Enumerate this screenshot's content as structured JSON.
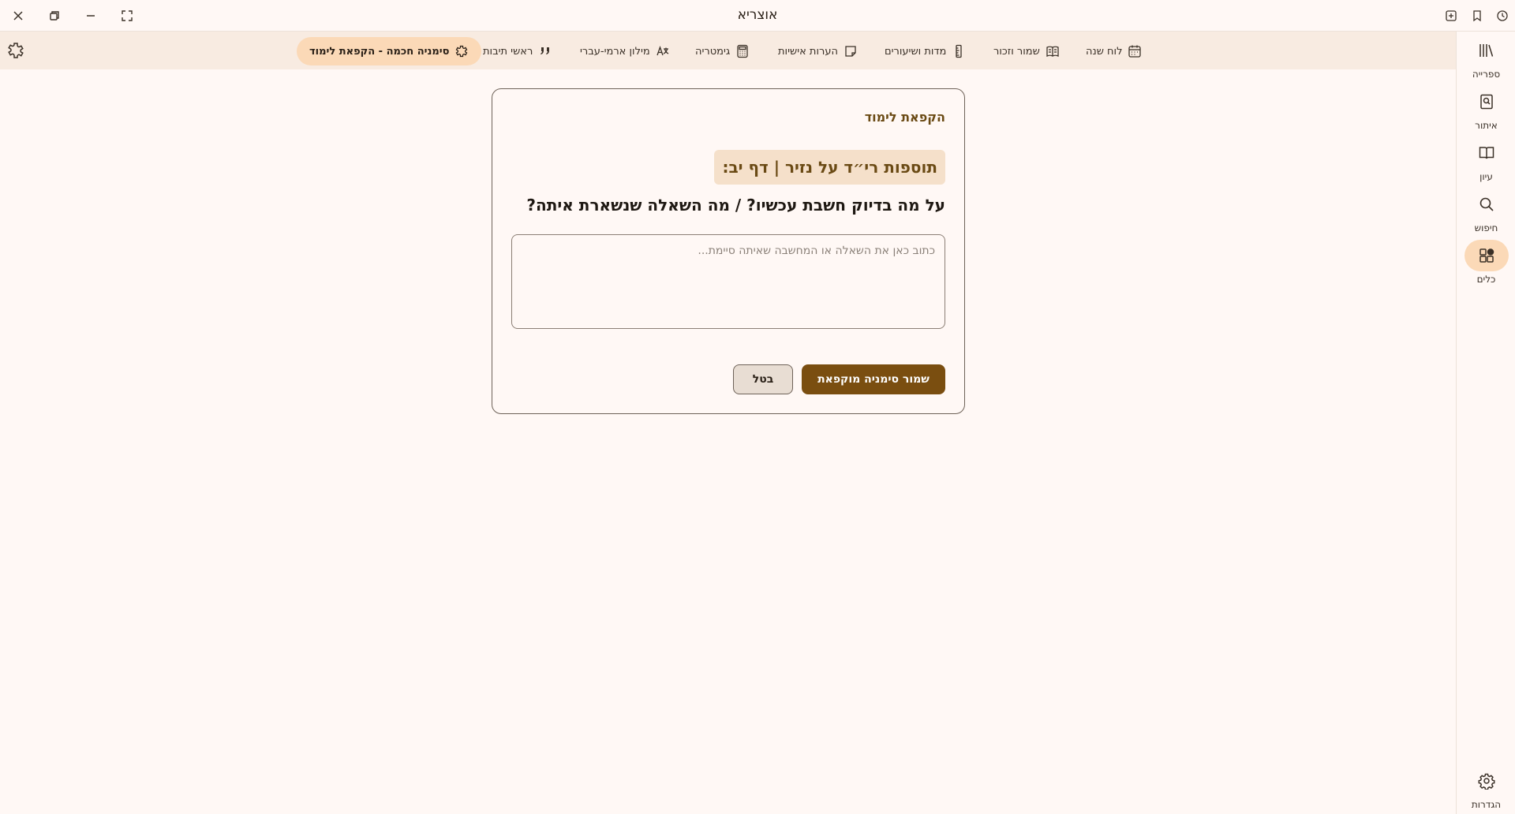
{
  "window": {
    "title": "אוצריא"
  },
  "toolbar": {
    "tools": [
      {
        "label": "לוח שנה",
        "icon": "calendar-icon"
      },
      {
        "label": "שמור וזכור",
        "icon": "open-book-icon"
      },
      {
        "label": "מדות ושיעורים",
        "icon": "ruler-icon"
      },
      {
        "label": "הערות אישיות",
        "icon": "sticky-note-icon"
      },
      {
        "label": "גימטריה",
        "icon": "calculator-icon"
      },
      {
        "label": "מילון ארמי-עברי",
        "icon": "translate-icon"
      },
      {
        "label": "ראשי תיבות",
        "icon": "quote-icon"
      },
      {
        "label": "סימניה חכמה - הקפאת לימוד",
        "icon": "puzzle-icon",
        "active": true
      }
    ]
  },
  "rail": {
    "items": [
      {
        "label": "ספרייה",
        "icon": "library-icon"
      },
      {
        "label": "איתור",
        "icon": "locate-book-icon"
      },
      {
        "label": "עיון",
        "icon": "reading-book-icon"
      },
      {
        "label": "חיפוש",
        "icon": "search-icon"
      },
      {
        "label": "כלים",
        "icon": "tools-grid-icon",
        "active": true
      },
      {
        "label": "הגדרות",
        "icon": "gear-icon"
      }
    ]
  },
  "dialog": {
    "title": "הקפאת לימוד",
    "book_ref": "תוספות רי״ד על נזיר | דף יב:",
    "question": "על מה בדיוק חשבת עכשיו? / מה השאלה שנשארת איתה?",
    "input_placeholder": "כתוב כאן את השאלה או המחשבה שאיתה סיימת...",
    "input_value": "",
    "save_label": "שמור סימניה מוקפאת",
    "cancel_label": "בטל"
  },
  "colors": {
    "background": "#fff8f5",
    "toolbar": "#f8ebe1",
    "accent_pill": "#fbd9b7",
    "primary_button": "#7a4e10",
    "heading_brown": "#6a4a14"
  }
}
